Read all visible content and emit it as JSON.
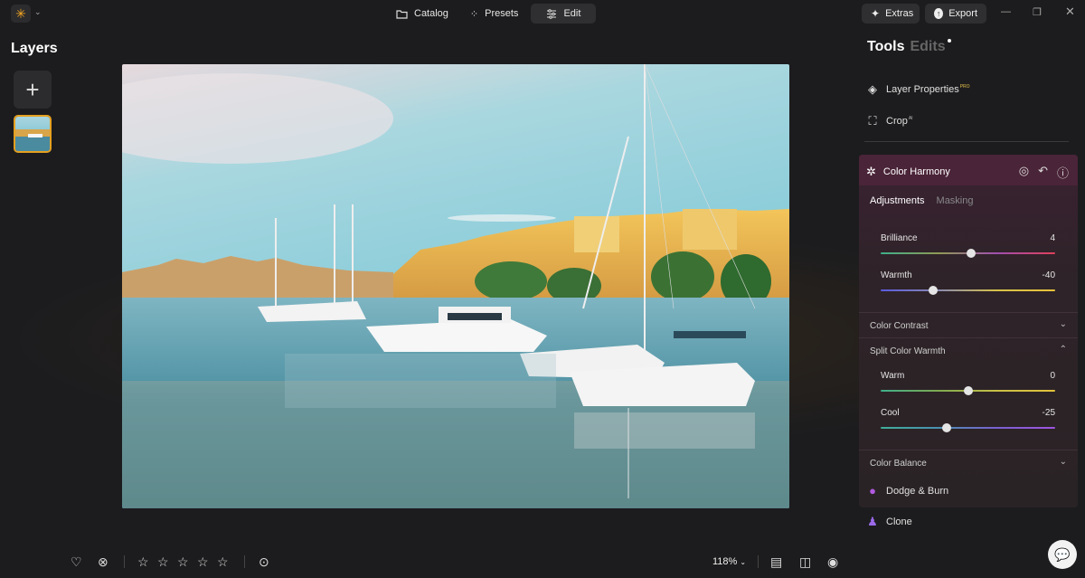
{
  "topbar": {
    "nav": [
      {
        "id": "catalog",
        "label": "Catalog",
        "icon": "folder-icon"
      },
      {
        "id": "presets",
        "label": "Presets",
        "icon": "magic-wand-icon"
      },
      {
        "id": "edit",
        "label": "Edit",
        "icon": "sliders-icon",
        "active": true
      }
    ],
    "extras_label": "Extras",
    "export_label": "Export"
  },
  "layers": {
    "title": "Layers"
  },
  "bottom": {
    "zoom": "118%",
    "rating_stars": 5
  },
  "panel": {
    "tab_tools": "Tools",
    "tab_edits": "Edits",
    "layer_properties": "Layer Properties",
    "layer_properties_badge": "PRO",
    "crop": "Crop",
    "crop_badge": "AI",
    "color_harmony": {
      "title": "Color Harmony",
      "subtab_adjustments": "Adjustments",
      "subtab_masking": "Masking",
      "brilliance": {
        "label": "Brilliance",
        "value": "4",
        "fraction": 0.52
      },
      "warmth": {
        "label": "Warmth",
        "value": "-40",
        "fraction": 0.3
      },
      "color_contrast": "Color Contrast",
      "split_color_warmth": "Split Color Warmth",
      "warm": {
        "label": "Warm",
        "value": "0",
        "fraction": 0.5
      },
      "cool": {
        "label": "Cool",
        "value": "-25",
        "fraction": 0.38
      },
      "color_balance": "Color Balance"
    },
    "dodge_burn": "Dodge & Burn",
    "clone": "Clone"
  },
  "colors": {
    "accent": "#e5a020",
    "harmony_header": "#4a2438",
    "dodge_icon": "#b05ae0",
    "clone_icon": "#9a6ae8"
  }
}
